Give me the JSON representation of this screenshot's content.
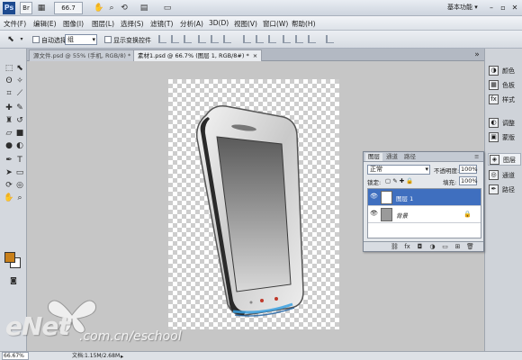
{
  "titlebar": {
    "app_logo": "Ps",
    "zoom_value": "66.7",
    "workspace": "基本功能"
  },
  "menubar": {
    "items": [
      "文件(F)",
      "编辑(E)",
      "图像(I)",
      "图层(L)",
      "选择(S)",
      "滤镜(T)",
      "分析(A)",
      "3D(D)",
      "视图(V)",
      "窗口(W)",
      "帮助(H)"
    ]
  },
  "options": {
    "auto_select_label": "自动选择:",
    "auto_select_value": "组",
    "transform_label": "显示变换控件"
  },
  "doc_tabs": [
    {
      "label": "源文件.psd @ 55% (手机, RGB/8) *",
      "active": false
    },
    {
      "label": "素材1.psd @ 66.7% (图层 1, RGB/8#) *",
      "active": true
    }
  ],
  "dock": {
    "items": [
      "颜色",
      "色板",
      "样式",
      "调整",
      "蒙版",
      "图层",
      "通道",
      "路径"
    ]
  },
  "layers_panel": {
    "tabs": [
      "图层",
      "通道",
      "路径"
    ],
    "blend_mode": "正常",
    "opacity_label": "不透明度:",
    "opacity_value": "100%",
    "lock_label": "锁定:",
    "fill_label": "填充:",
    "fill_value": "100%",
    "layers": [
      {
        "name": "图层 1",
        "selected": true
      },
      {
        "name": "背景",
        "selected": false
      }
    ]
  },
  "status": {
    "zoom": "66.67%",
    "doc_info": "文档:1.15M/2.68M"
  },
  "watermark": {
    "logo": "eNet",
    "url": ".com.cn/eschool"
  },
  "colors": {
    "foreground": "#c9801a",
    "background": "#ffffff",
    "selection": "#3f6fbf"
  }
}
